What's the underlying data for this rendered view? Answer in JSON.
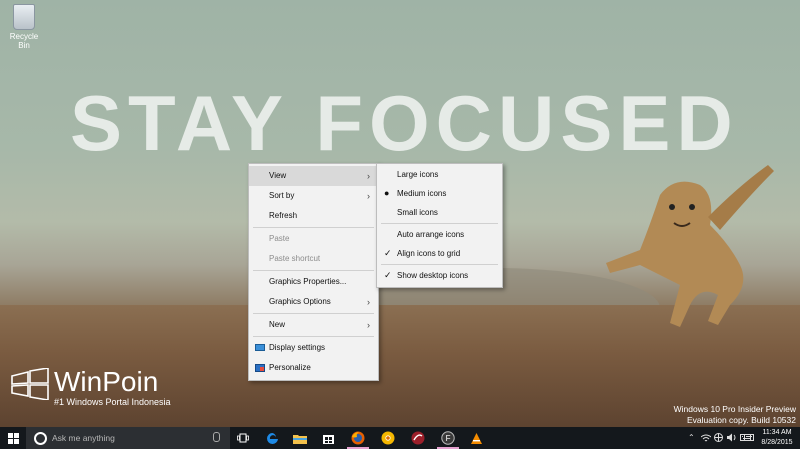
{
  "desktop": {
    "recycle_bin_label": "Recycle Bin",
    "wallpaper_text": "STAY FOCUSED",
    "watermark_logo": "WinPoin",
    "watermark_tagline": "#1 Windows Portal Indonesia",
    "os_watermark_line1": "Windows 10 Pro Insider Preview",
    "os_watermark_line2": "Evaluation copy. Build 10532"
  },
  "context_menu": {
    "items": [
      {
        "label": "View",
        "has_submenu": true,
        "active": true
      },
      {
        "label": "Sort by",
        "has_submenu": true
      },
      {
        "label": "Refresh"
      },
      {
        "label": "Paste",
        "disabled": true
      },
      {
        "label": "Paste shortcut",
        "disabled": true
      },
      {
        "label": "Graphics Properties..."
      },
      {
        "label": "Graphics Options",
        "has_submenu": true
      },
      {
        "label": "New",
        "has_submenu": true
      },
      {
        "label": "Display settings",
        "icon": "display-icon"
      },
      {
        "label": "Personalize",
        "icon": "personalize-icon"
      }
    ]
  },
  "view_submenu": {
    "items": [
      {
        "label": "Large icons"
      },
      {
        "label": "Medium icons",
        "selected": true
      },
      {
        "label": "Small icons"
      },
      {
        "label": "Auto arrange icons"
      },
      {
        "label": "Align icons to grid",
        "checked": true
      },
      {
        "label": "Show desktop icons",
        "checked": true
      }
    ]
  },
  "taskbar": {
    "search_placeholder": "Ask me anything",
    "apps": [
      "task-view-icon",
      "edge-icon",
      "file-explorer-icon",
      "store-icon",
      "firefox-icon",
      "chrome-canary-icon",
      "app-red-icon",
      "app-f-icon",
      "vlc-icon"
    ],
    "time": "11:34 AM",
    "date": "8/28/2015",
    "colors": {
      "bar": "#14181c",
      "search": "#2c2f33",
      "active_underline": "#e4a1cf"
    }
  }
}
